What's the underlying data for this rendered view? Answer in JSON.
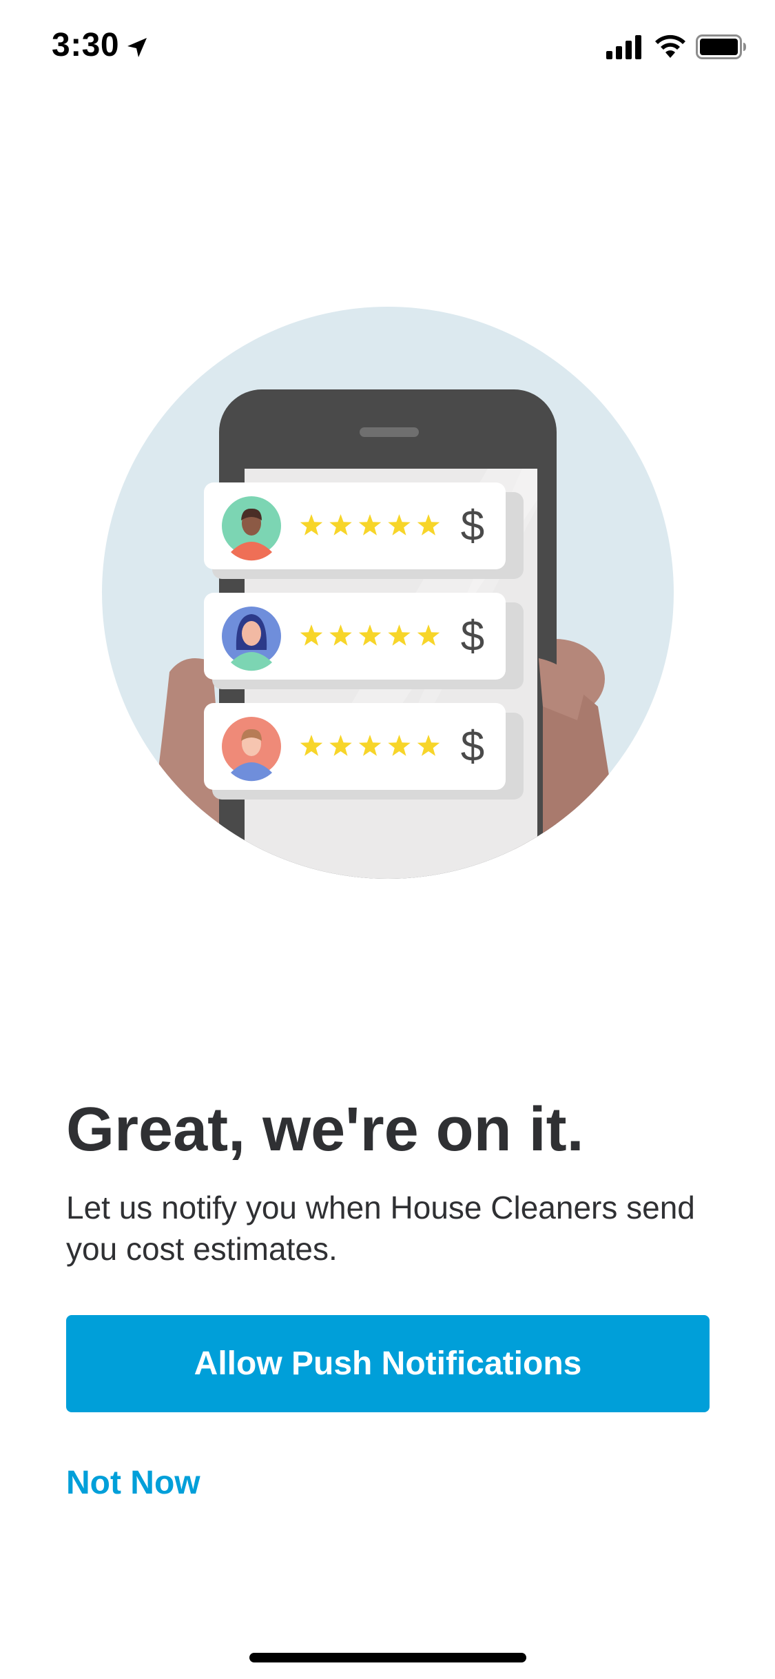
{
  "status_bar": {
    "time": "3:30"
  },
  "illustration": {
    "rows": [
      {
        "avatar": "person-avatar-1",
        "stars": 5,
        "price_symbol": "$"
      },
      {
        "avatar": "person-avatar-2",
        "stars": 5,
        "price_symbol": "$"
      },
      {
        "avatar": "person-avatar-3",
        "stars": 5,
        "price_symbol": "$"
      }
    ]
  },
  "content": {
    "title": "Great, we're on it.",
    "subtitle": "Let us notify you when House Cleaners send you cost estimates.",
    "allow_button_label": "Allow Push Notifications",
    "not_now_label": "Not Now"
  },
  "colors": {
    "accent": "#009fd9",
    "text": "#2f3033",
    "circle_bg": "#dce9ef",
    "star": "#f7d529"
  }
}
